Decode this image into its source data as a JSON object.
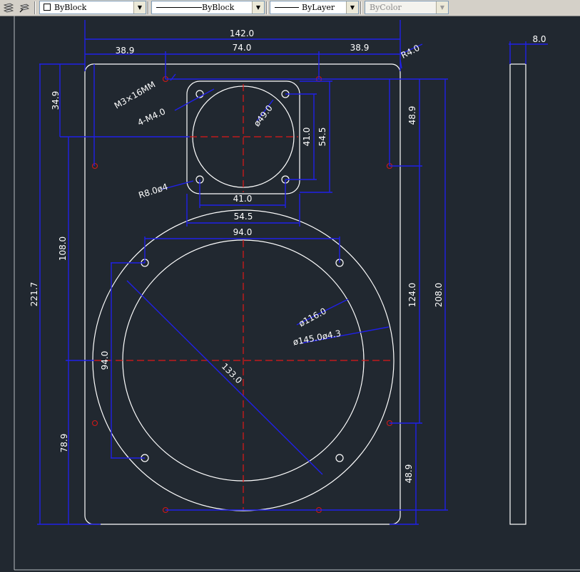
{
  "toolbar": {
    "layer_color_value": "ByBlock",
    "linetype_value": "ByBlock",
    "lineweight_value": "ByLayer",
    "plotstyle_value": "ByColor"
  },
  "dimensions": {
    "overall_width": "142.0",
    "center_span": "74.0",
    "left_offset": "38.9",
    "right_offset": "38.9",
    "corner_radius": "R4.0",
    "thickness": "8.0",
    "top_height": "34.9",
    "top_right_height": "48.9",
    "mount_screw_note": "M3×16MM",
    "tweeter_holes": "4-M4.0",
    "tweeter_dia": "ø49.0",
    "tweeter_hole_span_v": "41.0",
    "tweeter_flange_v": "54.5",
    "tweeter_corner": "R8.0ø4",
    "tweeter_hole_span_h": "41.0",
    "tweeter_flange_h": "54.5",
    "woofer_hole_span_h": "94.0",
    "woofer_inner_dia": "ø116.0",
    "woofer_outer_dia": "ø145.0ø4.3",
    "woofer_hole_span_v": "94.0",
    "woofer_diagonal": "133.0",
    "left_mid_height": "108.0",
    "total_height": "221.7",
    "bottom_left_height": "78.9",
    "right_span": "124.0",
    "right_total": "208.0",
    "bottom_right_height": "48.9"
  }
}
